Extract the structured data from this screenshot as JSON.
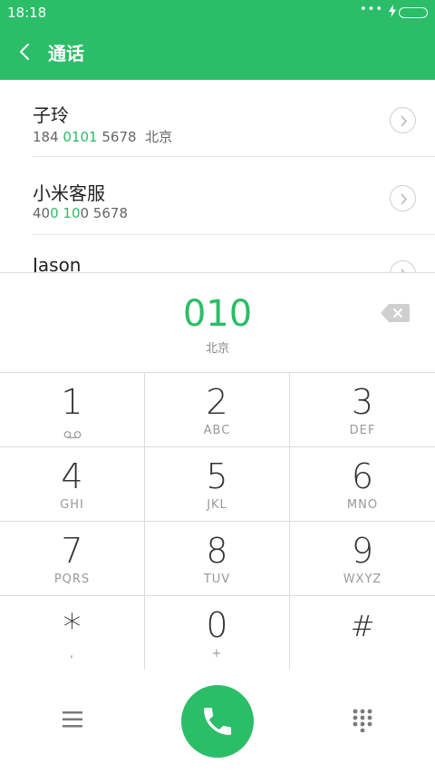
{
  "status_bar": {
    "time": "18:18",
    "dots": "•••",
    "accent_color": "#2bbd68"
  },
  "header": {
    "title": "通话"
  },
  "contacts": [
    {
      "name": "子玲",
      "number_before": "184 ",
      "number_highlight": "0101",
      "number_after": " 5678",
      "location": "北京"
    },
    {
      "name": "小米客服",
      "number_before": "40",
      "number_highlight": "0 10",
      "number_after": "0 5678",
      "location": ""
    },
    {
      "name": "Jason",
      "number_before": "",
      "number_highlight": "",
      "number_after": "",
      "location": ""
    }
  ],
  "entry": {
    "number": "010",
    "location": "北京"
  },
  "keypad": [
    {
      "digit": "1",
      "letters": ""
    },
    {
      "digit": "2",
      "letters": "ABC"
    },
    {
      "digit": "3",
      "letters": "DEF"
    },
    {
      "digit": "4",
      "letters": "GHI"
    },
    {
      "digit": "5",
      "letters": "JKL"
    },
    {
      "digit": "6",
      "letters": "MNO"
    },
    {
      "digit": "7",
      "letters": "PQRS"
    },
    {
      "digit": "8",
      "letters": "TUV"
    },
    {
      "digit": "9",
      "letters": "WXYZ"
    },
    {
      "digit": "*",
      "letters": ","
    },
    {
      "digit": "0",
      "letters": "+"
    },
    {
      "digit": "#",
      "letters": ""
    }
  ],
  "icons": {
    "back": "back-arrow-icon",
    "backspace": "backspace-icon",
    "voicemail": "voicemail-icon",
    "menu": "menu-icon",
    "call": "phone-icon",
    "dialpad": "dialpad-icon"
  }
}
